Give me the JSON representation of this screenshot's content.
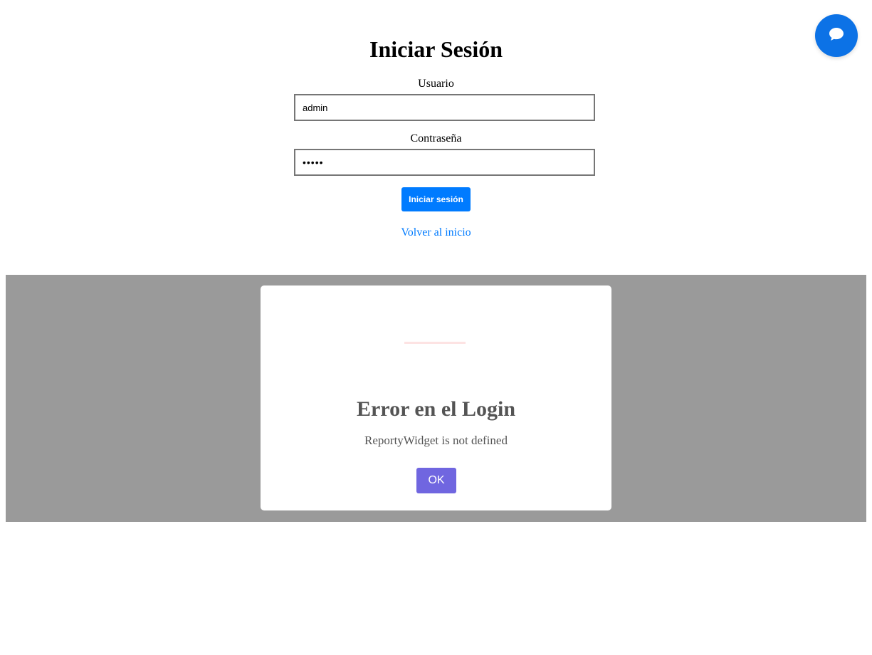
{
  "login": {
    "title": "Iniciar Sesión",
    "username_label": "Usuario",
    "username_value": "admin",
    "password_label": "Contraseña",
    "password_value": "•••••",
    "submit_label": "Iniciar sesión",
    "back_link": "Volver al inicio"
  },
  "chat": {
    "icon": "chat-bubble-icon",
    "color": "#0c72e6"
  },
  "modal": {
    "icon": "error-icon",
    "title": "Error en el Login",
    "message": "ReportyWidget is not defined",
    "ok_label": "OK",
    "ok_color": "#7066e0"
  },
  "colors": {
    "accent": "#007bff",
    "overlay": "#9a9a9a"
  }
}
